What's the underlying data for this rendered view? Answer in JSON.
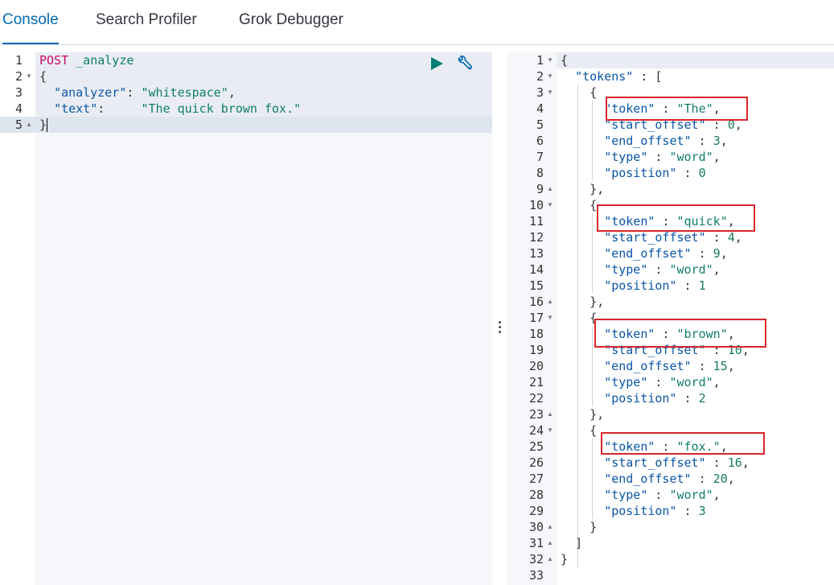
{
  "tabs": [
    {
      "label": "Console",
      "active": true
    },
    {
      "label": "Search Profiler",
      "active": false
    },
    {
      "label": "Grok Debugger",
      "active": false
    }
  ],
  "request": {
    "method": "POST",
    "url": "_analyze",
    "lines": [
      "POST _analyze",
      "{",
      "  \"analyzer\": \"whitespace\",",
      "  \"text\":     \"The quick brown fox.\"",
      "}"
    ],
    "body": {
      "analyzer_key": "\"analyzer\"",
      "analyzer_value": "\"whitespace\"",
      "text_key": "\"text\"",
      "text_value": "\"The quick brown fox.\""
    },
    "line_numbers": [
      "1",
      "2",
      "3",
      "4",
      "5"
    ]
  },
  "response": {
    "line_numbers": [
      "1",
      "2",
      "3",
      "4",
      "5",
      "6",
      "7",
      "8",
      "9",
      "10",
      "11",
      "12",
      "13",
      "14",
      "15",
      "16",
      "17",
      "18",
      "19",
      "20",
      "21",
      "22",
      "23",
      "24",
      "25",
      "26",
      "27",
      "28",
      "29",
      "30",
      "31",
      "32",
      "33"
    ],
    "tokens_key": "\"tokens\"",
    "fields": {
      "token": "\"token\"",
      "start_offset": "\"start_offset\"",
      "end_offset": "\"end_offset\"",
      "type": "\"type\"",
      "position": "\"position\""
    },
    "tokens": [
      {
        "token": "\"The\"",
        "start_offset": "0",
        "end_offset": "3",
        "type": "\"word\"",
        "position": "0"
      },
      {
        "token": "\"quick\"",
        "start_offset": "4",
        "end_offset": "9",
        "type": "\"word\"",
        "position": "1"
      },
      {
        "token": "\"brown\"",
        "start_offset": "10",
        "end_offset": "15",
        "type": "\"word\"",
        "position": "2"
      },
      {
        "token": "\"fox.\"",
        "start_offset": "16",
        "end_offset": "20",
        "type": "\"word\"",
        "position": "3"
      }
    ]
  },
  "icons": {
    "run": "play-icon",
    "settings": "wrench-icon",
    "resize": "vertical-dots-icon"
  },
  "colors": {
    "accent": "#006bb4",
    "run": "#017d73",
    "highlight_box": "#d9262c",
    "keyword": "#c80a68",
    "string": "#117d6b",
    "key": "#0a56a8",
    "active_line": "#e6ebf2",
    "request_bg": "#f5f7fa",
    "response_gutter_bg": "#f5f7fa"
  }
}
